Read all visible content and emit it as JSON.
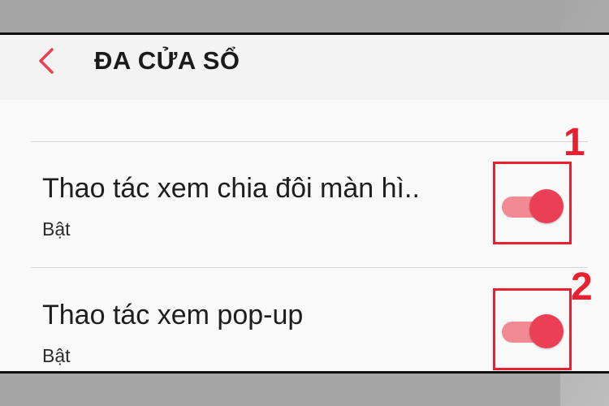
{
  "header": {
    "back_icon": "chevron-left-icon",
    "title": "ĐA CỬA SỔ"
  },
  "settings": [
    {
      "title": "Thao tác xem chia đôi màn hì..",
      "status": "Bật",
      "enabled": true,
      "marker": "1"
    },
    {
      "title": "Thao tác xem pop-up",
      "status": "Bật",
      "enabled": true,
      "marker": "2"
    }
  ],
  "colors": {
    "accent": "#ea3f55",
    "track": "#f28a94",
    "annotation": "#e8202f"
  }
}
